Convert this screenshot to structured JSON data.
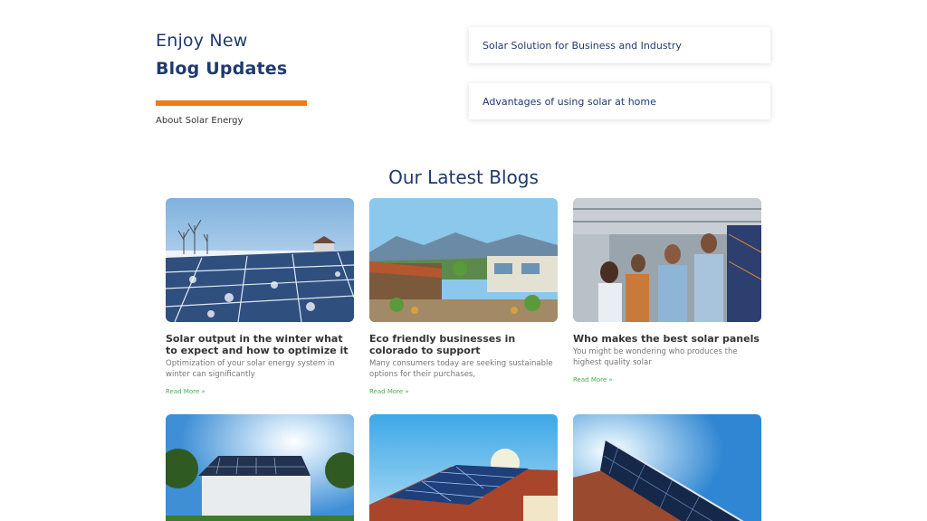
{
  "hero": {
    "title_line1": "Enjoy New",
    "title_line2": "Blog Updates",
    "subtitle": "About Solar Energy",
    "accent_color": "#f07b16"
  },
  "topics": [
    {
      "label": "Solar Solution for Business and Industry"
    },
    {
      "label": "Advantages of using solar at home"
    }
  ],
  "section_title": "Our Latest Blogs",
  "read_more_label": "Read More »",
  "blogs": [
    {
      "title": "Solar output in the winter what to expect and how to optimize it",
      "excerpt": "Optimization of your solar energy system in winter can significantly",
      "image": "snowy-solar-field-photo"
    },
    {
      "title": "Eco friendly businesses in colorado to support",
      "excerpt": "Many consumers today are seeking sustainable options for their purchases,",
      "image": "mountain-market-photo"
    },
    {
      "title": "Who makes the best solar panels",
      "excerpt": "You might be wondering who produces the highest quality solar",
      "image": "factory-workers-photo"
    },
    {
      "title": "",
      "excerpt": "",
      "image": "house-solar-roof-photo"
    },
    {
      "title": "",
      "excerpt": "",
      "image": "tiled-roof-solar-photo"
    },
    {
      "title": "",
      "excerpt": "",
      "image": "solar-panel-closeup-photo"
    }
  ],
  "colors": {
    "heading": "#1f3a6e",
    "read_more": "#4caf50",
    "accent": "#f07b16"
  }
}
